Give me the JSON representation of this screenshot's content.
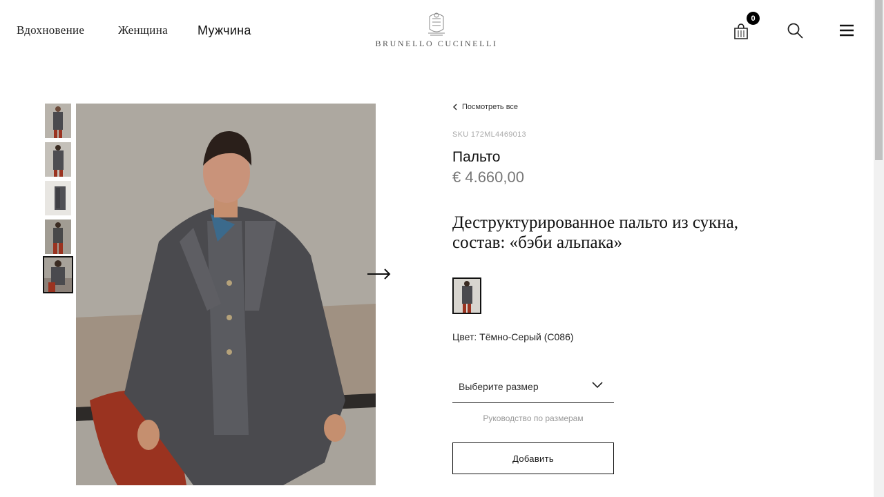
{
  "header": {
    "nav": [
      "Вдохновение",
      "Женщина",
      "Мужчина"
    ],
    "logo_text": "BRUNELLO CUCINELLI",
    "cart_count": "0",
    "icons": {
      "cart": "shopping-bag-icon",
      "search": "search-icon",
      "menu": "hamburger-menu-icon"
    }
  },
  "gallery": {
    "thumbnails_count": 5,
    "active_index": 4,
    "next_icon": "arrow-right-icon"
  },
  "product": {
    "back_label": "Посмотреть все",
    "sku": "SKU 172ML4469013",
    "title": "Пальто",
    "price": "€ 4.660,00",
    "description_line1": "Деструктурированное пальто из сукна,",
    "description_line2": "состав: «бэби альпака»",
    "color": "Цвет: Тёмно-Серый (C086)",
    "size_placeholder": "Выберите размер",
    "size_guide": "Руководство по размерам",
    "add_label": "Добавить"
  },
  "colors": {
    "text": "#111111",
    "muted": "#999999",
    "badge": "#000000",
    "coat": "#4a4a4e",
    "trousers": "#9a3320",
    "wall": "#a7a29a"
  }
}
